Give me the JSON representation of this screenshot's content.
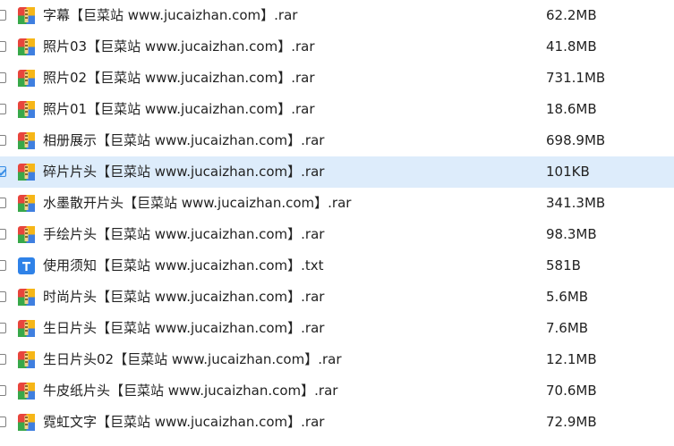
{
  "colors": {
    "selected_row_bg": "#ddecfb",
    "archive_icon_red": "#e8453c",
    "archive_icon_yellow": "#f6b617",
    "archive_icon_green": "#38a84a",
    "archive_icon_blue": "#3f7fe0",
    "text_icon_blue": "#2f82e8"
  },
  "files": [
    {
      "name": "字幕【巨菜站 www.jucaizhan.com】.rar",
      "size": "62.2MB",
      "icon": "archive-icon",
      "checked": false
    },
    {
      "name": "照片03【巨菜站 www.jucaizhan.com】.rar",
      "size": "41.8MB",
      "icon": "archive-icon",
      "checked": false
    },
    {
      "name": "照片02【巨菜站 www.jucaizhan.com】.rar",
      "size": "731.1MB",
      "icon": "archive-icon",
      "checked": false
    },
    {
      "name": "照片01【巨菜站 www.jucaizhan.com】.rar",
      "size": "18.6MB",
      "icon": "archive-icon",
      "checked": false
    },
    {
      "name": "相册展示【巨菜站 www.jucaizhan.com】.rar",
      "size": "698.9MB",
      "icon": "archive-icon",
      "checked": false
    },
    {
      "name": "碎片片头【巨菜站 www.jucaizhan.com】.rar",
      "size": "101KB",
      "icon": "archive-icon",
      "checked": true
    },
    {
      "name": "水墨散开片头【巨菜站 www.jucaizhan.com】.rar",
      "size": "341.3MB",
      "icon": "archive-icon",
      "checked": false
    },
    {
      "name": "手绘片头【巨菜站 www.jucaizhan.com】.rar",
      "size": "98.3MB",
      "icon": "archive-icon",
      "checked": false
    },
    {
      "name": "使用须知【巨菜站 www.jucaizhan.com】.txt",
      "size": "581B",
      "icon": "text-file-icon",
      "checked": false
    },
    {
      "name": "时尚片头【巨菜站 www.jucaizhan.com】.rar",
      "size": "5.6MB",
      "icon": "archive-icon",
      "checked": false
    },
    {
      "name": "生日片头【巨菜站 www.jucaizhan.com】.rar",
      "size": "7.6MB",
      "icon": "archive-icon",
      "checked": false
    },
    {
      "name": "生日片头02【巨菜站 www.jucaizhan.com】.rar",
      "size": "12.1MB",
      "icon": "archive-icon",
      "checked": false
    },
    {
      "name": "牛皮纸片头【巨菜站 www.jucaizhan.com】.rar",
      "size": "70.6MB",
      "icon": "archive-icon",
      "checked": false
    },
    {
      "name": "霓虹文字【巨菜站 www.jucaizhan.com】.rar",
      "size": "72.9MB",
      "icon": "archive-icon",
      "checked": false
    }
  ]
}
